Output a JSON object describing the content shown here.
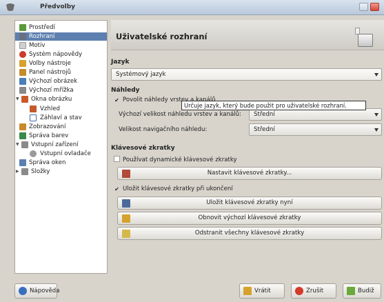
{
  "window": {
    "title": "Předvolby"
  },
  "sidebar": {
    "items": [
      {
        "label": "Prostředí",
        "icon": "environment-icon",
        "color": "#5b9a3a"
      },
      {
        "label": "Rozhraní",
        "icon": "interface-icon",
        "color": "#6a7080"
      },
      {
        "label": "Motiv",
        "icon": "theme-icon",
        "color": "#d0d0d0"
      },
      {
        "label": "Systém nápovědy",
        "icon": "help-system-icon",
        "color": "#cc3b2b"
      },
      {
        "label": "Volby nástroje",
        "icon": "tool-options-icon",
        "color": "#d6a22b"
      },
      {
        "label": "Panel nástrojů",
        "icon": "toolbox-icon",
        "color": "#c58b2b"
      },
      {
        "label": "Výchozí obrázek",
        "icon": "default-image-icon",
        "color": "#4a7fb8"
      },
      {
        "label": "Výchozí mřížka",
        "icon": "default-grid-icon",
        "color": "#8a8a8a"
      },
      {
        "label": "Okna obrázku",
        "icon": "image-windows-icon",
        "color": "#c85a2a"
      },
      {
        "label": "Vzhled",
        "icon": "appearance-icon",
        "color": "#c35a2a"
      },
      {
        "label": "Záhlaví a stav",
        "icon": "title-status-icon",
        "color": "#3a6fa8"
      },
      {
        "label": "Zobrazování",
        "icon": "display-icon",
        "color": "#c98a2b"
      },
      {
        "label": "Správa barev",
        "icon": "color-management-icon",
        "color": "#3a8a4a"
      },
      {
        "label": "Vstupní zařízení",
        "icon": "input-devices-icon",
        "color": "#8a8a8a"
      },
      {
        "label": "Vstupní ovladače",
        "icon": "input-controllers-icon",
        "color": "#9a9a9a"
      },
      {
        "label": "Správa oken",
        "icon": "window-management-icon",
        "color": "#5a7fb0"
      },
      {
        "label": "Složky",
        "icon": "folders-icon",
        "color": "#8a8a8a"
      }
    ]
  },
  "header": {
    "title": "Uživatelské rozhraní"
  },
  "language": {
    "section": "Jazyk",
    "value": "Systémový jazyk",
    "tooltip": "Určuje jazyk, který bude použit pro uživatelské rozhraní."
  },
  "previews": {
    "section": "Náhledy",
    "enable_label": "Povolit náhledy vrstev a kanálů",
    "size_label": "Výchozí velikost náhledu vrstev a kanálů:",
    "size_value": "Střední",
    "nav_label": "Velikost navigačního náhledu:",
    "nav_value": "Střední"
  },
  "shortcuts": {
    "section": "Klávesové zkratky",
    "dynamic_label": "Používat dynamické klávesové zkratky",
    "configure_button": "Nastavit klávesové zkratky...",
    "save_on_exit_label": "Uložit klávesové zkratky při ukončení",
    "save_now_button": "Uložit klávesové zkratky nyní",
    "reset_button": "Obnovit výchozí klávesové zkratky",
    "remove_button": "Odstranit všechny klávesové zkratky"
  },
  "footer": {
    "help_button": "Nápověda",
    "reset_button": "Vrátit",
    "cancel_button": "Zrušit",
    "ok_button": "Budiž"
  }
}
